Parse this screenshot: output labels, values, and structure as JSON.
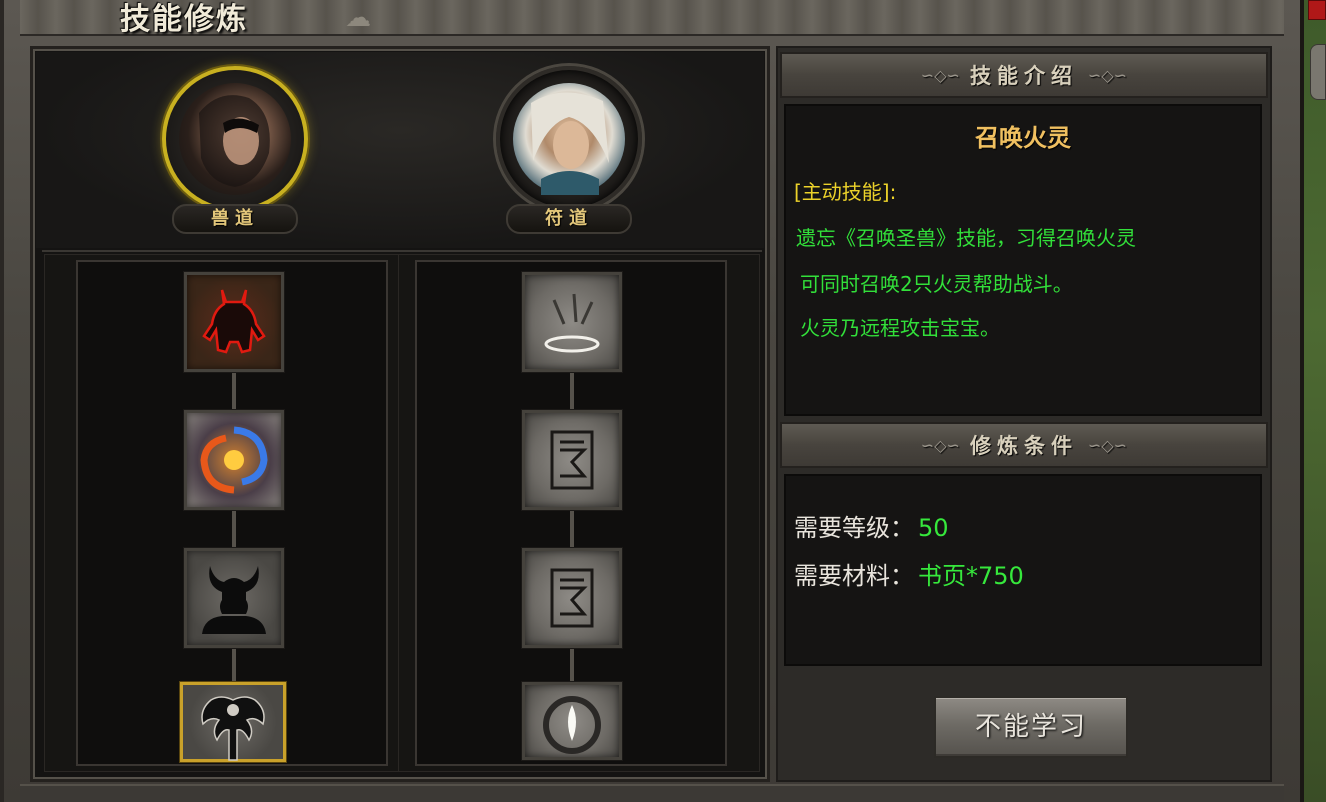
{
  "window": {
    "title": "技能修炼"
  },
  "schools": [
    {
      "label": "兽道",
      "active": true
    },
    {
      "label": "符道",
      "active": false
    }
  ],
  "skill_columns": [
    {
      "school": "兽道",
      "icons": [
        "demon-silhouette-icon",
        "fire-vortex-icon",
        "horned-helmet-icon",
        "winged-spirit-icon"
      ],
      "selected_index": 3
    },
    {
      "school": "符道",
      "icons": [
        "rune-circle-icon",
        "talisman-seal-icon",
        "talisman-seal-icon",
        "flame-ring-icon"
      ],
      "selected_index": null
    }
  ],
  "skill_intro": {
    "header": "技能介绍",
    "name": "召唤火灵",
    "type": "[主动技能]:",
    "lines": [
      "遗忘《召唤圣兽》技能，习得召唤火灵",
      "可同时召唤2只火灵帮助战斗。",
      "火灵乃远程攻击宝宝。"
    ]
  },
  "requirements": {
    "header": "修炼条件",
    "level_label": "需要等级：",
    "level_value": "50",
    "material_label": "需要材料：",
    "material_value": "书页*750"
  },
  "learn_button": {
    "label": "不能学习",
    "enabled": false
  },
  "colors": {
    "active_gold": "#c8b020",
    "skill_name": "#f0c060",
    "skill_type": "#ecd22a",
    "desc_green": "#32e03a",
    "req_value_green": "#36e83c"
  }
}
